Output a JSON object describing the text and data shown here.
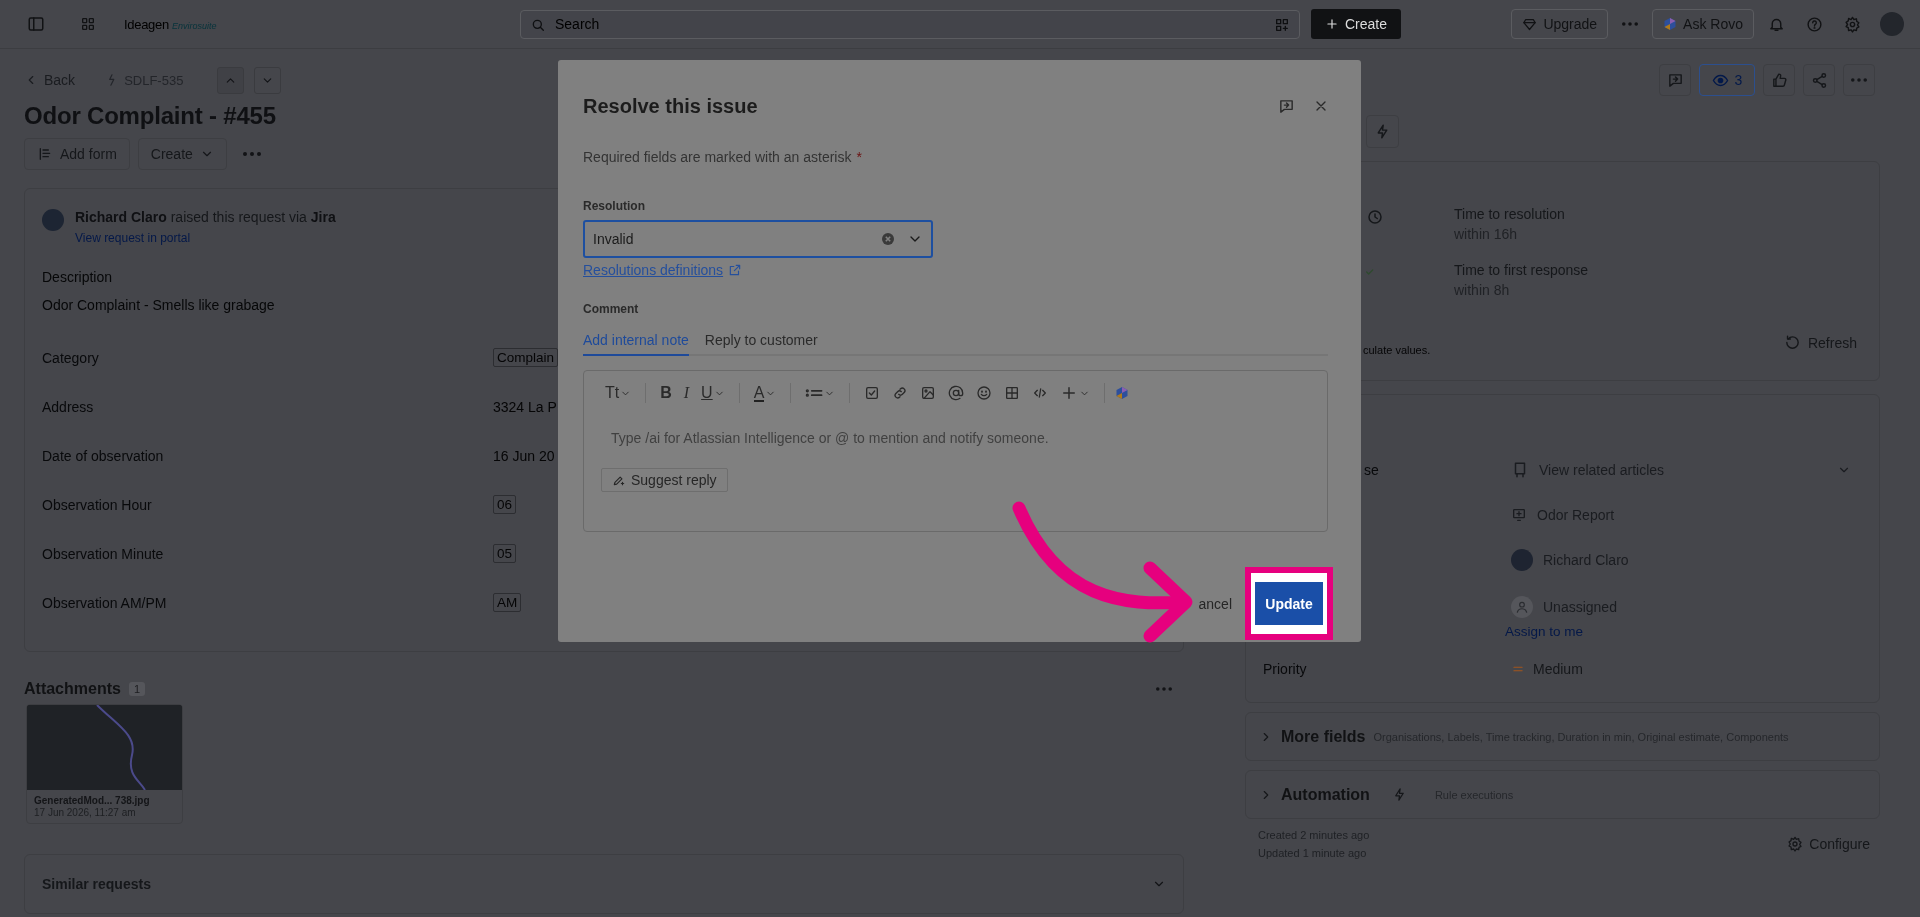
{
  "top_bar": {
    "logo": {
      "name": "Ideagen",
      "product": "Envirosuite"
    },
    "search": {
      "placeholder": "Search"
    },
    "create_button": "Create",
    "upgrade_button": "Upgrade",
    "ask_rovo_button": "Ask Rovo"
  },
  "issue": {
    "back": "Back",
    "key": "SDLF-535",
    "title": "Odor Complaint - #455",
    "add_form": "Add form",
    "create": "Create",
    "reporter_line": "**Richard Claro** raised this request via **Jira**",
    "portal_link": "View request in portal",
    "description_label": "Description",
    "description": "Odor Complaint - Smells like grabage",
    "fields": [
      {
        "label": "Category",
        "value": "Complain",
        "kind": "tag"
      },
      {
        "label": "Address",
        "value": "3324 La P",
        "kind": "text"
      },
      {
        "label": "Date of observation",
        "value": "16 Jun 20",
        "kind": "text"
      },
      {
        "label": "Observation Hour",
        "value": "06",
        "kind": "tag"
      },
      {
        "label": "Observation Minute",
        "value": "05",
        "kind": "tag"
      },
      {
        "label": "Observation AM/PM",
        "value": "AM",
        "kind": "tag"
      }
    ],
    "attachments": {
      "title": "Attachments",
      "count": "1",
      "files": [
        {
          "name": "GeneratedMod... 738.jpg",
          "date": "17 Jun 2026, 11:27 am"
        }
      ]
    },
    "similar_requests": "Similar requests"
  },
  "sidebar": {
    "watchers": "3",
    "sla": [
      {
        "name": "Time to resolution",
        "target": "within 16h",
        "kind": "clock"
      },
      {
        "name": "Time to first response",
        "target": "within 8h",
        "kind": "done"
      }
    ],
    "sla_note": "culate values.",
    "refresh": "Refresh",
    "details": {
      "partial_label": "se",
      "rows": [
        {
          "kind": "articles",
          "value": "View related articles"
        },
        {
          "kind": "request_type",
          "value": "Odor Report"
        },
        {
          "kind": "person",
          "value": "Richard Claro"
        },
        {
          "kind": "unassigned",
          "value": "Unassigned",
          "link": "Assign to me"
        }
      ],
      "priority": {
        "label": "Priority",
        "value": "Medium"
      }
    },
    "more_fields": {
      "title": "More fields",
      "summary": "Organisations, Labels, Time tracking, Duration in min, Original estimate, Components"
    },
    "automation": {
      "title": "Automation",
      "summary": "Rule executions"
    },
    "created": "Created 2 minutes ago",
    "updated": "Updated 1 minute ago",
    "configure": "Configure"
  },
  "modal": {
    "title": "Resolve this issue",
    "required_note": "Required fields are marked with an asterisk",
    "required_mark": "*",
    "resolution": {
      "label": "Resolution",
      "value": "Invalid"
    },
    "definitions_link": "Resolutions definitions",
    "comment_label": "Comment",
    "comment_tabs": [
      {
        "label": "Add internal note",
        "selected": true
      },
      {
        "label": "Reply to customer",
        "selected": false
      }
    ],
    "toolbar_glyphs": [
      "Tt",
      "B",
      "I",
      "U",
      "A"
    ],
    "editor_placeholder": "Type /ai for Atlassian Intelligence or @ to mention and notify someone.",
    "suggest_reply": "Suggest reply",
    "cancel": "ancel",
    "update": "Update"
  }
}
